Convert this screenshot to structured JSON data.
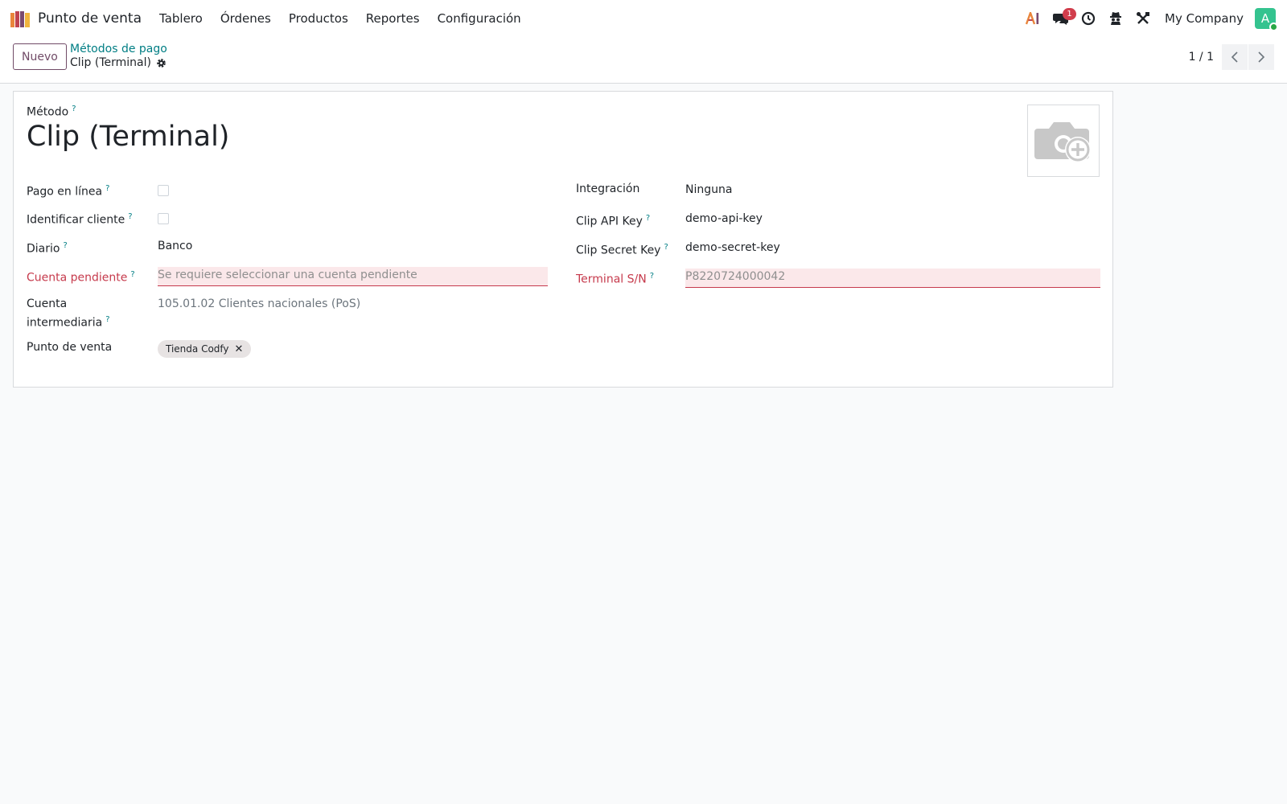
{
  "navbar": {
    "app_name": "Punto de venta",
    "menu": [
      "Tablero",
      "Órdenes",
      "Productos",
      "Reportes",
      "Configuración"
    ],
    "chat_badge": "1",
    "company": "My Company",
    "avatar_letter": "A",
    "icons": [
      "ai-icon",
      "chat-icon",
      "clock-icon",
      "spy-icon",
      "tools-icon"
    ]
  },
  "control_panel": {
    "new_button": "Nuevo",
    "breadcrumb": "Métodos de pago",
    "record_title": "Clip (Terminal)",
    "pager": "1 / 1"
  },
  "form": {
    "method_label": "Método",
    "help_mark": "?",
    "method_name": "Clip (Terminal)",
    "left": {
      "online_payment_label": "Pago en línea",
      "identify_customer_label": "Identificar cliente",
      "journal_label": "Diario",
      "journal_value": "Banco",
      "pending_account_label": "Cuenta pendiente",
      "pending_account_placeholder": "Se requiere seleccionar una cuenta pendiente",
      "intermediary_label_1": "Cuenta",
      "intermediary_label_2": "intermediaria",
      "intermediary_value": "105.01.02 Clientes nacionales (PoS)",
      "pos_label": "Punto de venta",
      "pos_tag": "Tienda Codfy",
      "tag_remove": "✕"
    },
    "right": {
      "integration_label": "Integración",
      "integration_value": "Ninguna",
      "api_key_label": "Clip API Key",
      "api_key_value": "demo-api-key",
      "secret_key_label": "Clip Secret Key",
      "secret_key_value": "demo-secret-key",
      "terminal_label": "Terminal S/N",
      "terminal_placeholder": "P8220724000042"
    }
  },
  "colors": {
    "accent": "#714b67",
    "link": "#017e84",
    "required": "#c63a4c",
    "required_bg": "#fbe8ea"
  }
}
